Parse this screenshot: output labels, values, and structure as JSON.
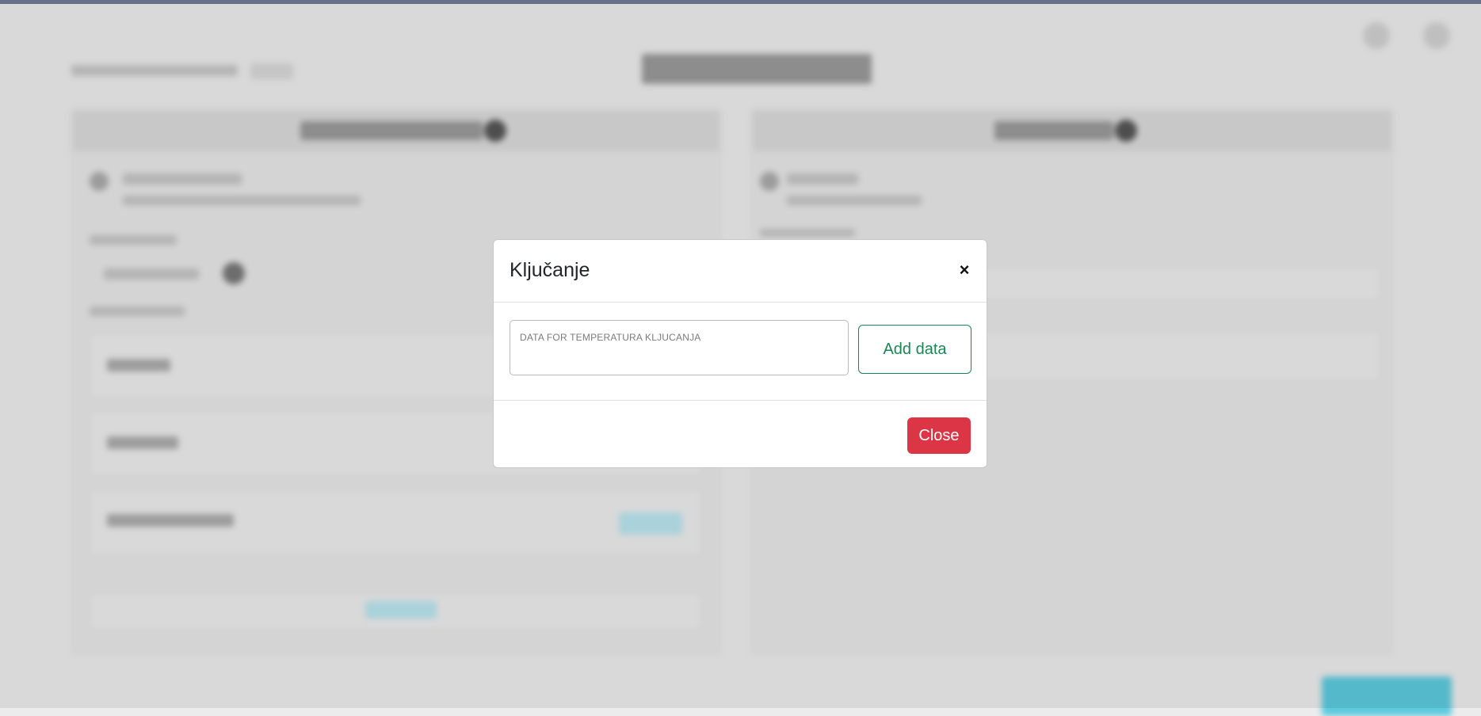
{
  "modal": {
    "title": "Ključanje",
    "close_icon": "×",
    "input_label": "DATA FOR TEMPERATURA KLJUCANJA",
    "input_value": "",
    "add_button_label": "Add data",
    "close_button_label": "Close"
  },
  "colors": {
    "add_button": "#198754",
    "close_button": "#dc3545",
    "top_bar": "#6f7a96"
  },
  "icons": {
    "modal_close": "close-icon"
  }
}
